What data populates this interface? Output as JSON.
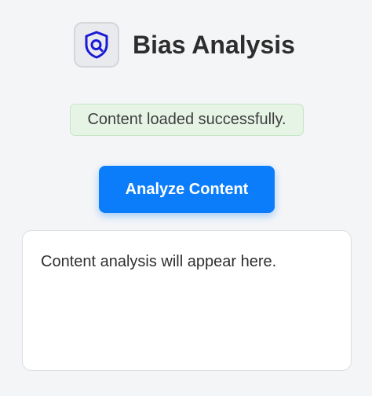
{
  "header": {
    "icon": "shield-search-icon",
    "title": "Bias Analysis",
    "accent_color": "#1a1ad6"
  },
  "status": {
    "message": "Content loaded successfully.",
    "type": "success"
  },
  "actions": {
    "analyze_label": "Analyze Content",
    "button_color": "#0b7dfb"
  },
  "result": {
    "placeholder": "Content analysis will appear here."
  }
}
